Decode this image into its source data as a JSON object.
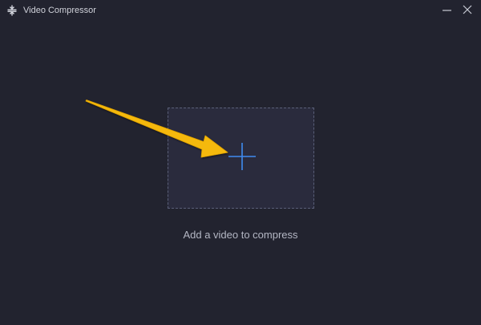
{
  "window": {
    "title": "Video Compressor",
    "app_icon": "compress-icon",
    "controls": {
      "minimize_icon": "minimize-icon",
      "close_icon": "close-icon"
    }
  },
  "main": {
    "dropzone": {
      "icon": "plus-icon",
      "hint": "Add a video to compress"
    },
    "annotation": {
      "icon": "arrow-icon",
      "color": "#f5b90a"
    }
  },
  "colors": {
    "background": "#22232f",
    "dropzone_fill": "#2a2b3d",
    "dropzone_border": "#5a5f78",
    "accent": "#3f8bf0"
  }
}
